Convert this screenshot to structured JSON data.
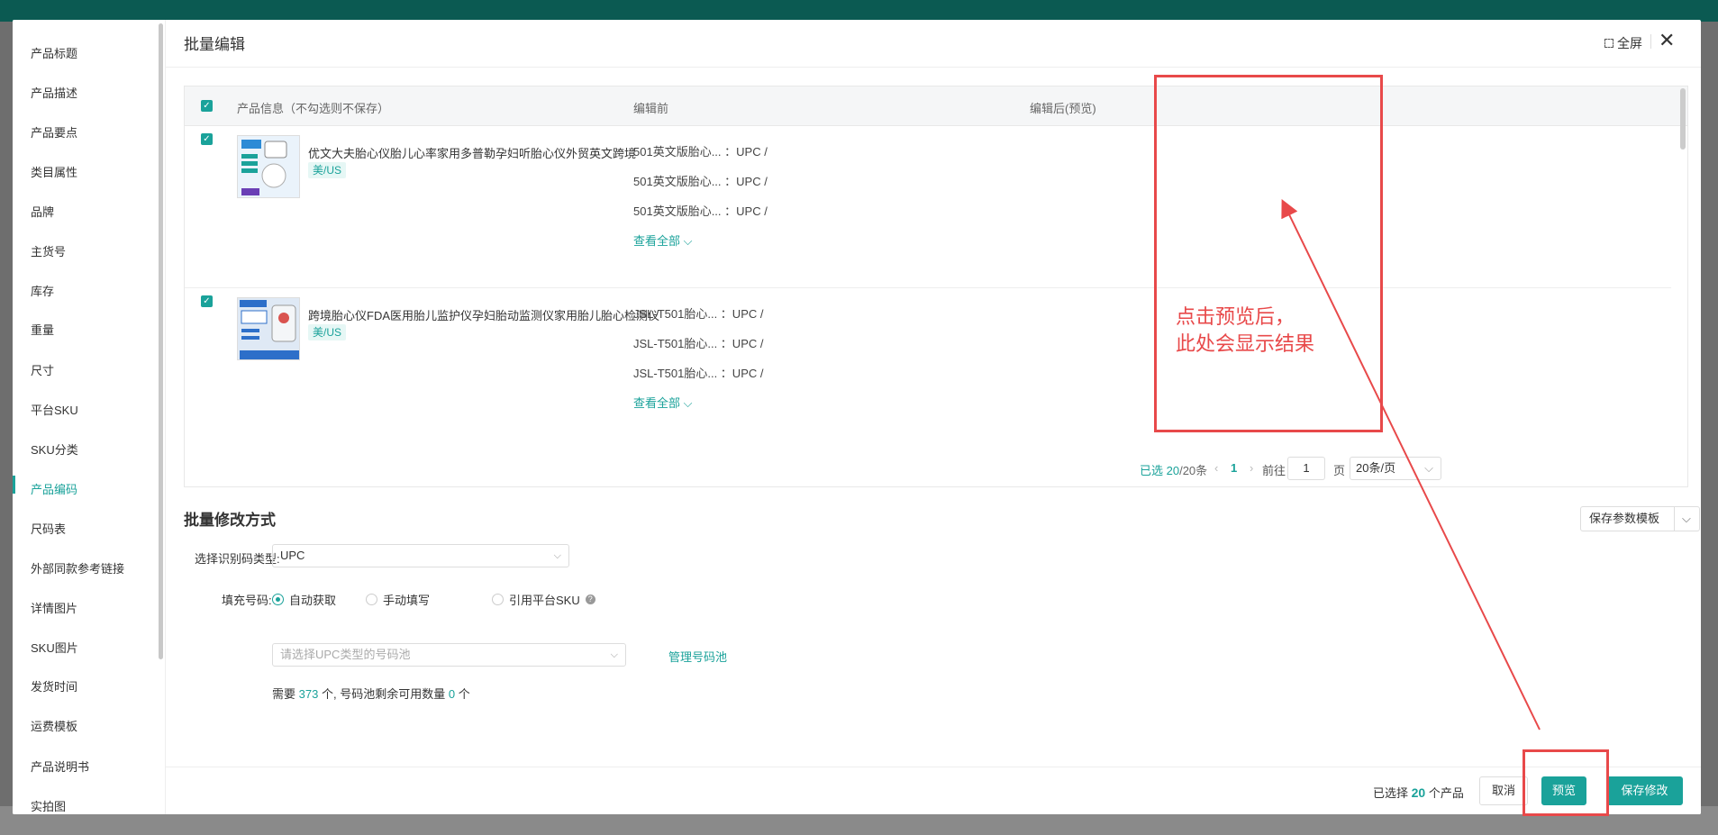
{
  "colors": {
    "accent": "#1aa29a",
    "annotation": "#e8494a"
  },
  "left_nav": {
    "items": [
      {
        "label": "产品标题"
      },
      {
        "label": "产品描述"
      },
      {
        "label": "产品要点"
      },
      {
        "label": "类目属性"
      },
      {
        "label": "品牌"
      },
      {
        "label": "主货号"
      },
      {
        "label": "库存"
      },
      {
        "label": "重量"
      },
      {
        "label": "尺寸"
      },
      {
        "label": "平台SKU"
      },
      {
        "label": "SKU分类"
      },
      {
        "label": "产品编码"
      },
      {
        "label": "尺码表"
      },
      {
        "label": "外部同款参考链接"
      },
      {
        "label": "详情图片"
      },
      {
        "label": "SKU图片"
      },
      {
        "label": "发货时间"
      },
      {
        "label": "运费模板"
      },
      {
        "label": "产品说明书"
      },
      {
        "label": "实拍图"
      }
    ],
    "active_label": "产品编码"
  },
  "header": {
    "title": "批量编辑",
    "fullscreen_label": "全屏",
    "close_icon": "close-icon"
  },
  "table": {
    "columns": {
      "product_info": "产品信息（不勾选则不保存）",
      "before": "编辑前",
      "after": "编辑后(预览)"
    },
    "rows": [
      {
        "name": "优文大夫胎心仪胎儿心率家用多普勒孕妇听胎心仪外贸英文跨境",
        "region": "美/US",
        "before": [
          "501英文版胎心... ：UPC /",
          "501英文版胎心... ：UPC /",
          "501英文版胎心... ：UPC /"
        ],
        "view_all": "查看全部"
      },
      {
        "name": "跨境胎心仪FDA医用胎儿监护仪孕妇胎动监测仪家用胎儿胎心检测仪",
        "region": "美/US",
        "before": [
          "JSL-T501胎心... ：UPC /",
          "JSL-T501胎心... ：UPC /",
          "JSL-T501胎心... ：UPC /"
        ],
        "view_all": "查看全部"
      }
    ]
  },
  "pager": {
    "selected_prefix": "已选 20",
    "total_suffix": "/20条",
    "current_page": "1",
    "goto_label": "前往",
    "goto_value": "1",
    "page_unit": "页",
    "page_size": "20条/页"
  },
  "batch": {
    "title": "批量修改方式",
    "save_template": "保存参数模板",
    "code_type_label": "选择识别码类型:",
    "code_type_value": "UPC",
    "fill_label": "填充号码:",
    "radio_auto": "自动获取",
    "radio_manual": "手动填写",
    "radio_platform": "引用平台SKU",
    "pool_placeholder": "请选择UPC类型的号码池",
    "manage_pool": "管理号码池",
    "need_prefix": "需要",
    "need_count": "373",
    "need_middle": "个, 号码池剩余可用数量",
    "pool_remaining": "0",
    "need_suffix": "个"
  },
  "footer": {
    "selected_prefix": "已选择",
    "selected_count": "20",
    "selected_suffix": "个产品",
    "cancel": "取消",
    "preview": "预览",
    "save": "保存修改"
  },
  "annotation": {
    "line1": "点击预览后，",
    "line2": "此处会显示结果"
  }
}
